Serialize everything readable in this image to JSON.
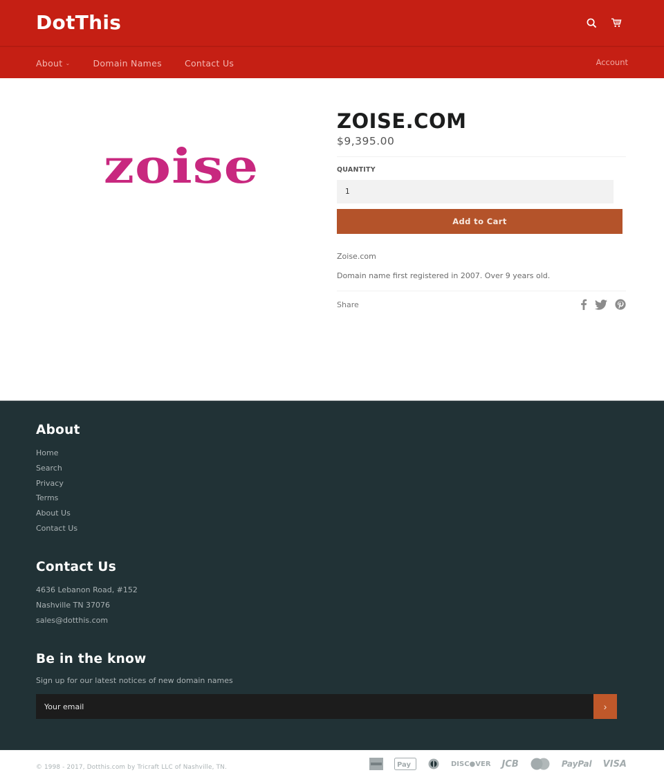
{
  "header": {
    "logo": "DotThis",
    "icons": [
      "search-icon",
      "cart-icon"
    ]
  },
  "nav": {
    "items": [
      {
        "label": "About",
        "has_dropdown": true
      },
      {
        "label": "Domain Names",
        "has_dropdown": false
      },
      {
        "label": "Contact Us",
        "has_dropdown": false
      }
    ],
    "account_label": "Account"
  },
  "product": {
    "image_text": "zoise",
    "title": "ZOISE.COM",
    "price": "$9,395.00",
    "quantity_label": "QUANTITY",
    "quantity_value": "1",
    "add_to_cart_label": "Add to Cart",
    "description": [
      "Zoise.com",
      "Domain name first registered in 2007.  Over 9 years old."
    ],
    "share_label": "Share",
    "share_icons": [
      "facebook-icon",
      "twitter-icon",
      "pinterest-icon"
    ]
  },
  "footer": {
    "about": {
      "heading": "About",
      "links": [
        "Home",
        "Search",
        "Privacy",
        "Terms",
        "About Us",
        "Contact Us"
      ]
    },
    "contact": {
      "heading": "Contact Us",
      "lines": [
        "4636 Lebanon Road, #152",
        "Nashville TN 37076",
        "sales@dotthis.com"
      ]
    },
    "newsletter": {
      "heading": "Be in the know",
      "text": "Sign up for our latest notices of new domain names",
      "email_placeholder": "Your email",
      "submit_icon": "chevron-right-icon"
    },
    "copyright": "© 1998 - 2017, Dotthis.com by Tricraft LLC of Nashville, TN.",
    "payment_methods": [
      "American Express",
      "Apple Pay",
      "Diners Club",
      "DISCOVER",
      "JCB",
      "MasterCard",
      "PayPal",
      "VISA"
    ]
  },
  "colors": {
    "header_bg": "#c51f14",
    "add_to_cart_bg": "#b4532a",
    "footer_bg": "#213236",
    "brand_logo": "#c8287f"
  }
}
